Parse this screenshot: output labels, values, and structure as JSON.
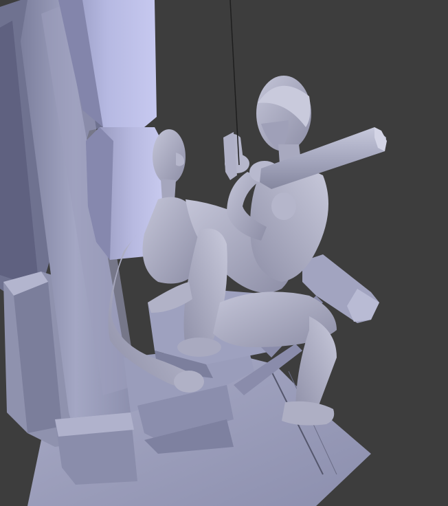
{
  "viewport": {
    "background": "#3d3d3d",
    "shading": "solid-matcap",
    "material_color": "#a6a8c4"
  },
  "scene": {
    "objects": [
      "machine-frame",
      "machine-pad",
      "seated-figure",
      "standing-figure",
      "cylinder-rod",
      "suspension-cable",
      "floor-plane"
    ]
  }
}
